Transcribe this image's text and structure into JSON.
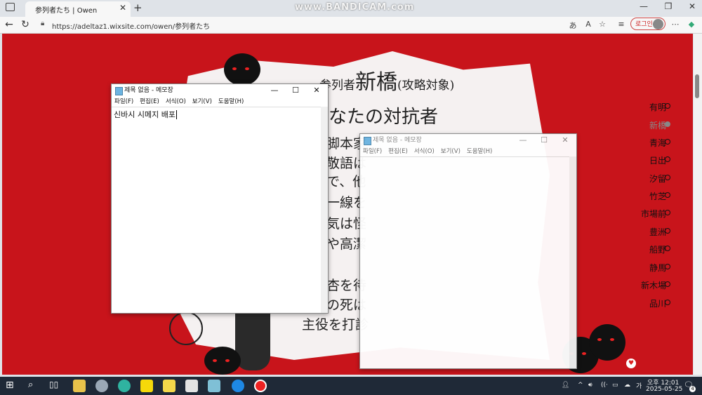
{
  "browser": {
    "tab_title": "参列者たち | Owen",
    "url": "https://adeltaz1.wixsite.com/owen/参列者たち",
    "login_label": "로그인",
    "watermark": "www.BANDICAM.com"
  },
  "page": {
    "title_prefix": "参列者",
    "title_name": "新橋",
    "title_suffix": "(攻略対象)",
    "tagline": "なたの対抗者",
    "body_lines": [
      "脚本家",
      "敬語は",
      "で、他",
      "一線を",
      "気は怪",
      "や高潔",
      "杏を待",
      "の死は",
      "主役を打診"
    ],
    "nav": [
      "有明",
      "新橋",
      "青海",
      "日出",
      "汐留",
      "竹芝",
      "市場前",
      "豊洲",
      "船野",
      "静馬",
      "新木場",
      "品川"
    ],
    "nav_active_index": 1,
    "colors": {
      "background": "#c8141b",
      "paper": "#f5f1f1"
    }
  },
  "notepad1": {
    "title": "제목 없음 - 메모장",
    "menu": [
      "파일(F)",
      "편집(E)",
      "서식(O)",
      "보기(V)",
      "도움말(H)"
    ],
    "text": "신바시 시메지 배포"
  },
  "notepad2": {
    "title": "제목 없음 - 메모장",
    "menu": [
      "파일(F)",
      "편집(E)",
      "서식(O)",
      "보기(V)",
      "도움말(H)"
    ],
    "text": ""
  },
  "taskbar": {
    "time": "오후 12:01",
    "date": "2025-05-25",
    "notification_count": "4",
    "ime": "가"
  }
}
